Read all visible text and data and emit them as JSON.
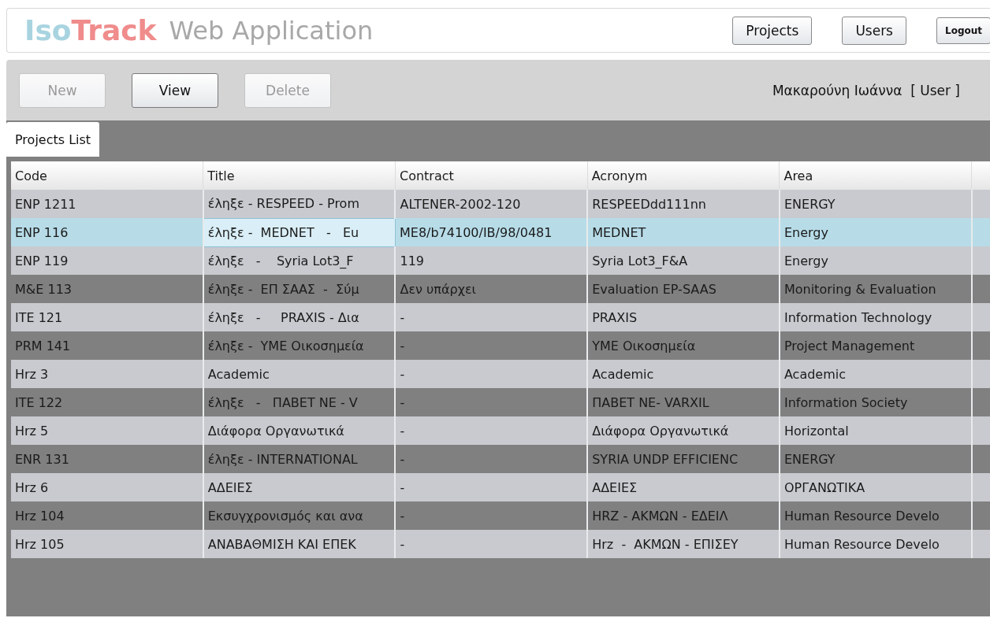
{
  "header": {
    "logo": {
      "part_1": "Iso",
      "part_2": "Track"
    },
    "title": "Web Application",
    "nav": [
      {
        "label": "Projects",
        "kind": "normal"
      },
      {
        "label": "Users",
        "kind": "normal"
      },
      {
        "label": "Logout",
        "kind": "small"
      }
    ]
  },
  "toolbar": {
    "buttons": [
      {
        "label": "New",
        "disabled": true
      },
      {
        "label": "View",
        "disabled": false
      },
      {
        "label": "Delete",
        "disabled": true
      }
    ],
    "user": "Μακαρούνη Ιωάννα  [ User ]"
  },
  "tabs": [
    {
      "label": "Projects List",
      "selected": true
    }
  ],
  "table": {
    "columns": [
      "Code",
      "Title",
      "Contract",
      "Acronym",
      "Area"
    ],
    "rows": [
      {
        "selected": false,
        "shaded": false,
        "cells": [
          {
            "text": "ENP 1211",
            "focused": false
          },
          {
            "text": "έληξε - RESPEED - Prom",
            "focused": false
          },
          {
            "text": "ALTENER-2002-120",
            "focused": false
          },
          {
            "text": "RESPEEDdd111nn",
            "focused": false
          },
          {
            "text": "ENERGY",
            "focused": false
          }
        ]
      },
      {
        "selected": true,
        "shaded": false,
        "cells": [
          {
            "text": "ENP 116",
            "focused": false
          },
          {
            "text": "έληξε -  MEDNET   -   Eu",
            "focused": true
          },
          {
            "text": "ME8/b74100/IB/98/0481",
            "focused": false
          },
          {
            "text": "MEDNET",
            "focused": false
          },
          {
            "text": "Energy",
            "focused": false
          }
        ]
      },
      {
        "selected": false,
        "shaded": false,
        "cells": [
          {
            "text": "ENP 119",
            "focused": false
          },
          {
            "text": "έληξε   -    Syria Lot3_F",
            "focused": false
          },
          {
            "text": "119",
            "focused": false
          },
          {
            "text": "Syria Lot3_F&A",
            "focused": false
          },
          {
            "text": "Energy",
            "focused": false
          }
        ]
      },
      {
        "selected": false,
        "shaded": true,
        "cells": [
          {
            "text": "M&E 113",
            "focused": false
          },
          {
            "text": "έληξε -  ΕΠ ΣΑΑΣ  -  Σύμ",
            "focused": false
          },
          {
            "text": "Δεν υπάρχει",
            "focused": false
          },
          {
            "text": "Evaluation EP-SAAS",
            "focused": false
          },
          {
            "text": "Monitoring & Evaluation",
            "focused": false
          }
        ]
      },
      {
        "selected": false,
        "shaded": false,
        "cells": [
          {
            "text": "ITE 121",
            "focused": false
          },
          {
            "text": "έληξε   -     PRAXIS - Δια",
            "focused": false
          },
          {
            "text": "-",
            "focused": false
          },
          {
            "text": "PRAXIS",
            "focused": false
          },
          {
            "text": "Information Technology",
            "focused": false
          }
        ]
      },
      {
        "selected": false,
        "shaded": true,
        "cells": [
          {
            "text": "PRM 141",
            "focused": false
          },
          {
            "text": "έληξε -  ΥΜΕ Οικοσημεία",
            "focused": false
          },
          {
            "text": "-",
            "focused": false
          },
          {
            "text": "ΥΜΕ Οικοσημεία",
            "focused": false
          },
          {
            "text": "Project Management",
            "focused": false
          }
        ]
      },
      {
        "selected": false,
        "shaded": false,
        "cells": [
          {
            "text": "Hrz 3",
            "focused": false
          },
          {
            "text": "Academic",
            "focused": false
          },
          {
            "text": "-",
            "focused": false
          },
          {
            "text": "Academic",
            "focused": false
          },
          {
            "text": "Academic",
            "focused": false
          }
        ]
      },
      {
        "selected": false,
        "shaded": true,
        "cells": [
          {
            "text": "ITE 122",
            "focused": false
          },
          {
            "text": "έληξε   -   ΠΑΒΕΤ ΝΕ - V",
            "focused": false
          },
          {
            "text": "-",
            "focused": false
          },
          {
            "text": "ΠΑΒΕΤ ΝΕ- VARXIL",
            "focused": false
          },
          {
            "text": "Information Society",
            "focused": false
          }
        ]
      },
      {
        "selected": false,
        "shaded": false,
        "cells": [
          {
            "text": "Hrz 5",
            "focused": false
          },
          {
            "text": "Διάφορα Οργανωτικά",
            "focused": false
          },
          {
            "text": "-",
            "focused": false
          },
          {
            "text": "Διάφορα Οργανωτικά",
            "focused": false
          },
          {
            "text": "Horizontal",
            "focused": false
          }
        ]
      },
      {
        "selected": false,
        "shaded": true,
        "cells": [
          {
            "text": "ENR 131",
            "focused": false
          },
          {
            "text": "έληξε - INTERNATIONAL",
            "focused": false
          },
          {
            "text": "-",
            "focused": false
          },
          {
            "text": "SYRIA UNDP EFFICIENC",
            "focused": false
          },
          {
            "text": "ENERGY",
            "focused": false
          }
        ]
      },
      {
        "selected": false,
        "shaded": false,
        "cells": [
          {
            "text": "Hrz 6",
            "focused": false
          },
          {
            "text": "ΑΔΕΙΕΣ",
            "focused": false
          },
          {
            "text": "-",
            "focused": false
          },
          {
            "text": "ΑΔΕΙΕΣ",
            "focused": false
          },
          {
            "text": "ΟΡΓΑΝΩΤΙΚΑ",
            "focused": false
          }
        ]
      },
      {
        "selected": false,
        "shaded": true,
        "cells": [
          {
            "text": "Hrz 104",
            "focused": false
          },
          {
            "text": "Εκσυγχρονισμός και ανα",
            "focused": false
          },
          {
            "text": "-",
            "focused": false
          },
          {
            "text": "HRZ - ΑΚΜΩΝ - ΕΔΕΙΛ",
            "focused": false
          },
          {
            "text": "Human Resource Develo",
            "focused": false
          }
        ]
      },
      {
        "selected": false,
        "shaded": false,
        "cells": [
          {
            "text": "Hrz 105",
            "focused": false
          },
          {
            "text": "ΑΝΑΒΑΘΜΙΣΗ ΚΑΙ ΕΠΕΚ",
            "focused": false
          },
          {
            "text": "-",
            "focused": false
          },
          {
            "text": "Hrz  -  ΑΚΜΩΝ - ΕΠΙΣΕΥ",
            "focused": false
          },
          {
            "text": "Human Resource Develo",
            "focused": false
          }
        ]
      }
    ]
  }
}
